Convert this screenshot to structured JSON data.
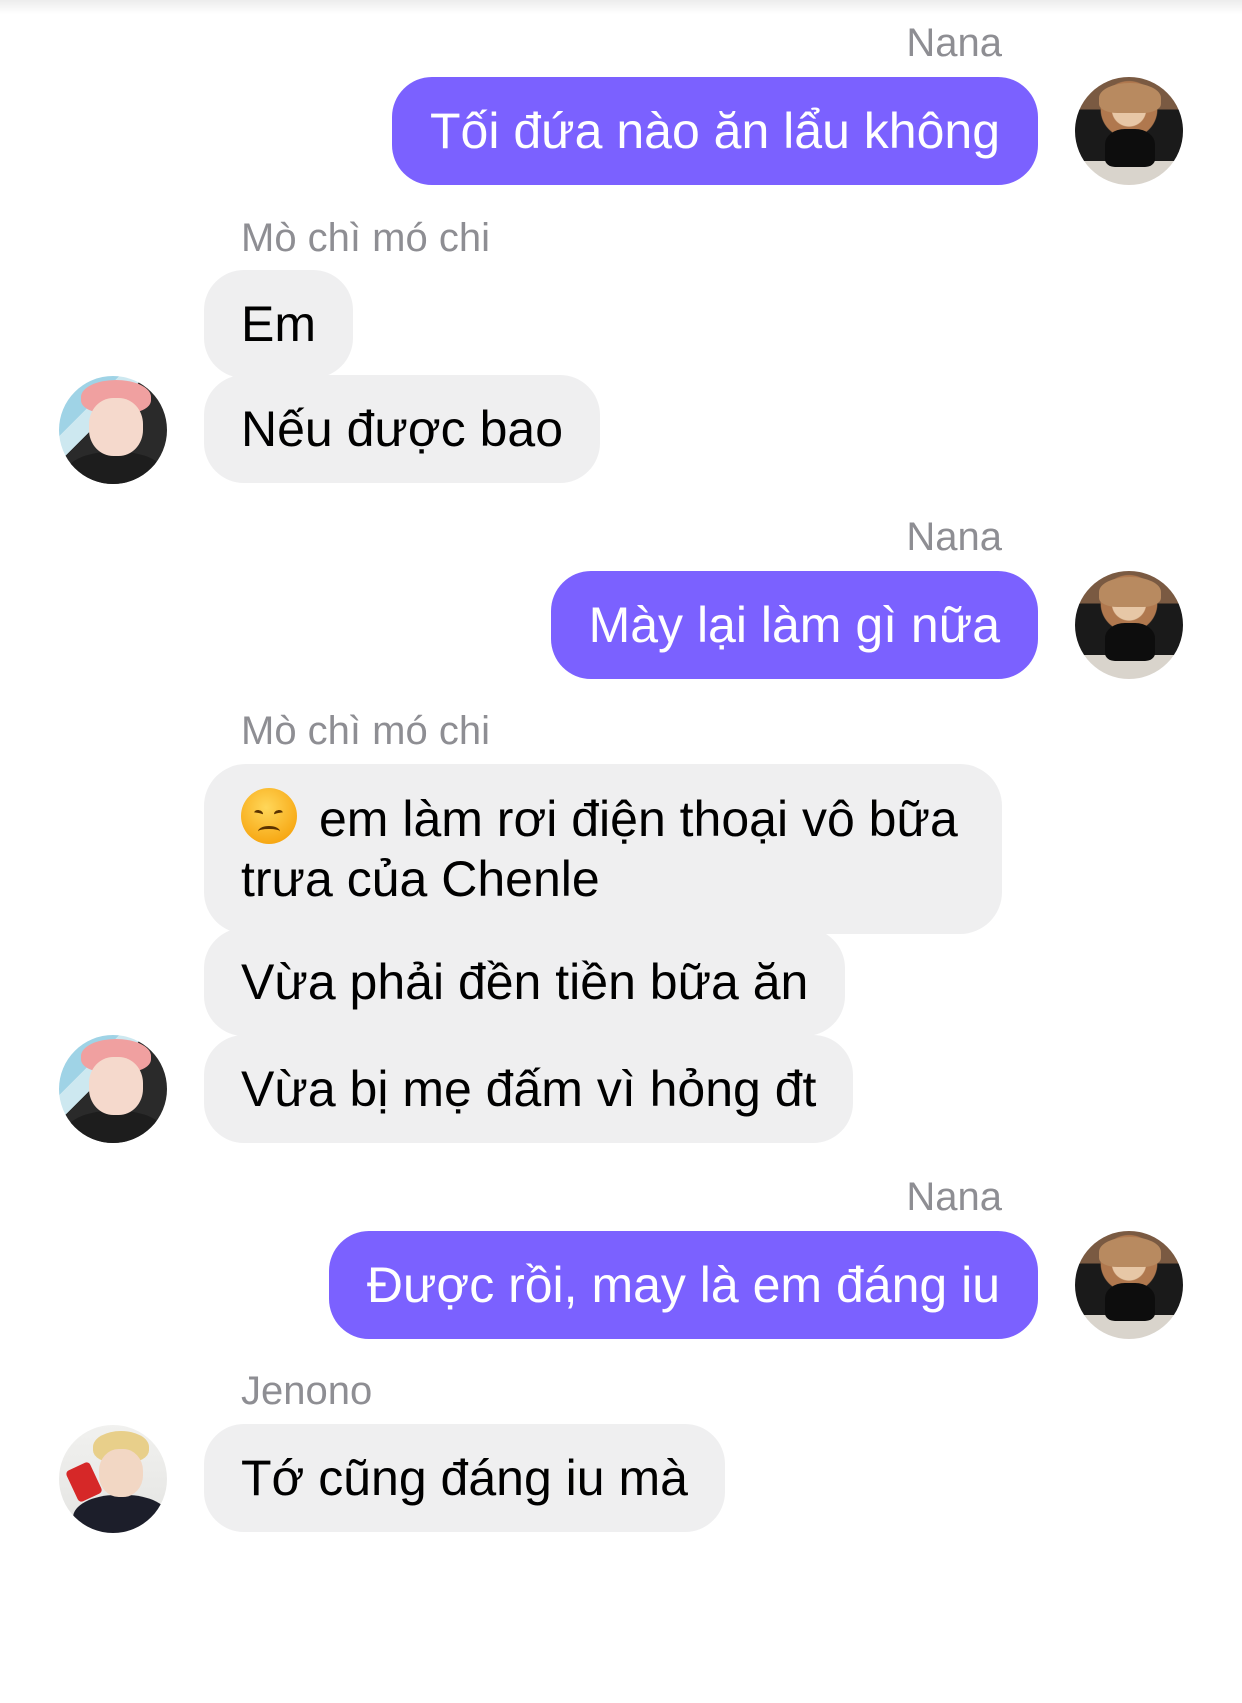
{
  "conversation": {
    "groups": [
      {
        "sender": "Nana",
        "direction": "outgoing",
        "messages": [
          "Tối đứa nào ăn lẩu không"
        ]
      },
      {
        "sender": "Mò chì mó chi",
        "direction": "incoming",
        "messages": [
          "Em",
          "Nếu được bao"
        ]
      },
      {
        "sender": "Nana",
        "direction": "outgoing",
        "messages": [
          "Mày lại làm gì nữa"
        ]
      },
      {
        "sender": "Mò chì mó chi",
        "direction": "incoming",
        "messages": [
          "em làm rơi điện thoại vô bữa trưa của Chenle",
          "Vừa phải đền tiền bữa ăn",
          "Vừa bị mẹ đấm vì hỏng đt"
        ],
        "emoji": "disappointed-face"
      },
      {
        "sender": "Nana",
        "direction": "outgoing",
        "messages": [
          "Được rồi, may là em đáng iu"
        ]
      },
      {
        "sender": "Jenono",
        "direction": "incoming",
        "messages": [
          "Tớ cũng đáng iu mà"
        ]
      }
    ]
  },
  "colors": {
    "outgoing_bubble": "#7b61ff",
    "incoming_bubble": "#efeff0",
    "sender_name": "#8e8e93"
  }
}
